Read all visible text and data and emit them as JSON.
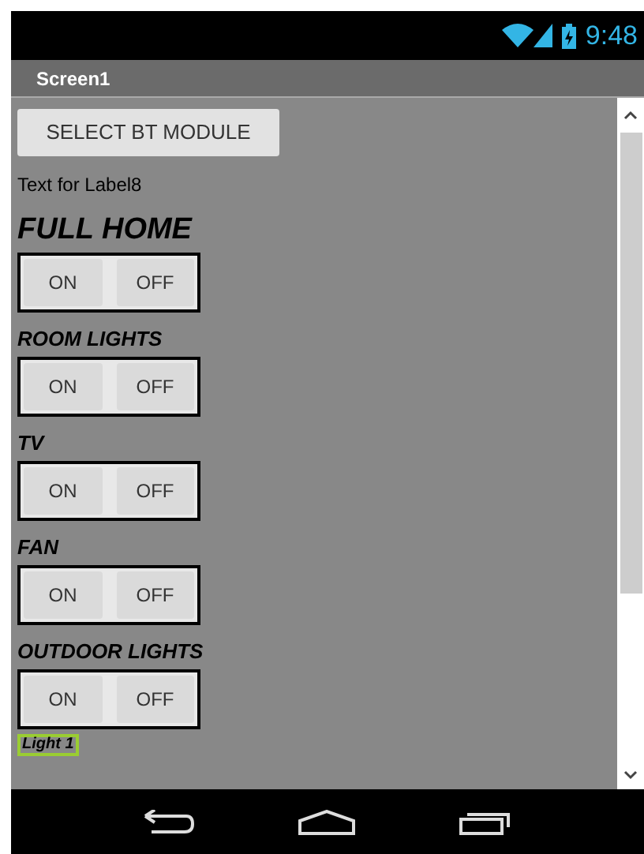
{
  "status_bar": {
    "time": "9:48"
  },
  "title_bar": {
    "title": "Screen1"
  },
  "select_button": {
    "label": "SELECT BT MODULE"
  },
  "info_label": "Text for Label8",
  "sections": [
    {
      "kind": "large",
      "title": "FULL HOME",
      "buttons": [
        "ON",
        "OFF"
      ]
    },
    {
      "kind": "small",
      "title": "ROOM LIGHTS",
      "buttons": [
        "ON",
        "OFF"
      ]
    },
    {
      "kind": "small",
      "title": "TV",
      "buttons": [
        "ON",
        "OFF"
      ]
    },
    {
      "kind": "small",
      "title": "FAN",
      "buttons": [
        "ON",
        "OFF"
      ]
    },
    {
      "kind": "small",
      "title": "OUTDOOR LIGHTS",
      "buttons": [
        "ON",
        "OFF"
      ]
    }
  ],
  "footer_label": "Light 1"
}
